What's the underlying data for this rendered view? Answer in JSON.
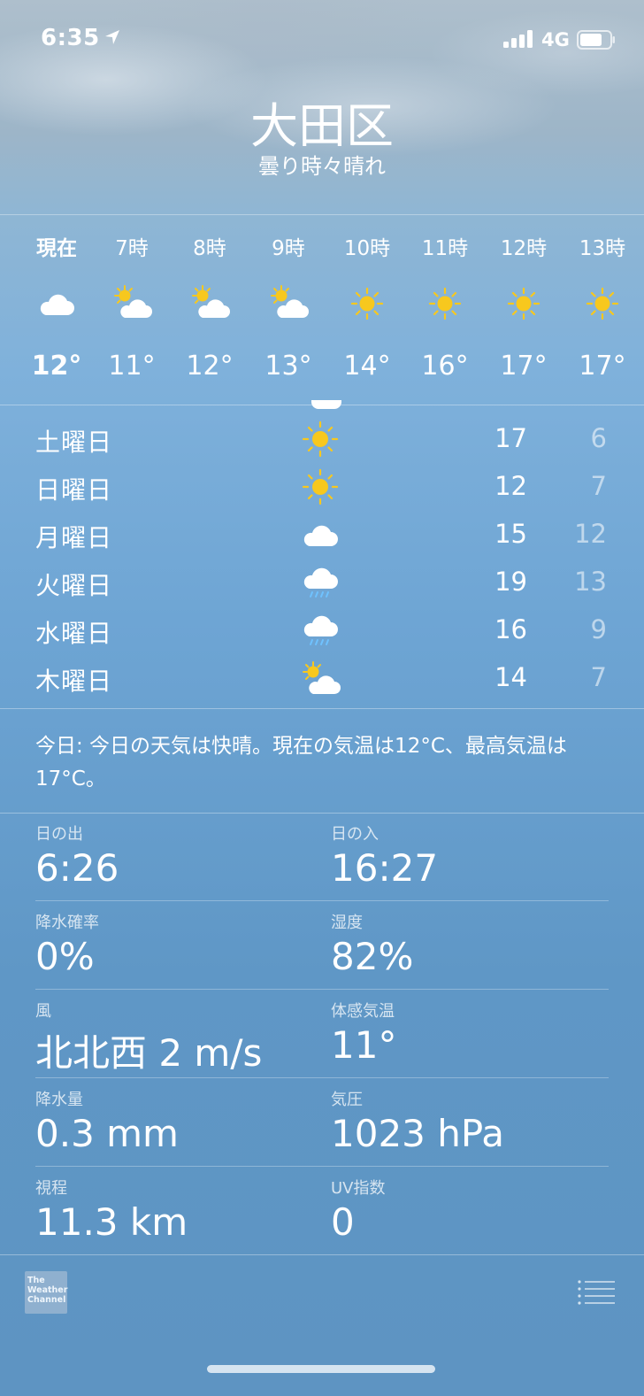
{
  "status_bar": {
    "time": "6:35",
    "network": "4G"
  },
  "location": {
    "city": "大田区",
    "condition": "曇り時々晴れ"
  },
  "hourly": [
    {
      "label": "現在",
      "icon": "cloud-icon",
      "temp": "12°"
    },
    {
      "label": "7時",
      "icon": "partly-sunny-icon",
      "temp": "11°"
    },
    {
      "label": "8時",
      "icon": "partly-sunny-icon",
      "temp": "12°"
    },
    {
      "label": "9時",
      "icon": "partly-sunny-icon",
      "temp": "13°"
    },
    {
      "label": "10時",
      "icon": "sun-icon",
      "temp": "14°"
    },
    {
      "label": "11時",
      "icon": "sun-icon",
      "temp": "16°"
    },
    {
      "label": "12時",
      "icon": "sun-icon",
      "temp": "17°"
    },
    {
      "label": "13時",
      "icon": "sun-icon",
      "temp": "17°"
    }
  ],
  "daily": [
    {
      "day": "土曜日",
      "icon": "sun-icon",
      "high": "17",
      "low": "6"
    },
    {
      "day": "日曜日",
      "icon": "sun-icon",
      "high": "12",
      "low": "7"
    },
    {
      "day": "月曜日",
      "icon": "cloud-icon",
      "high": "15",
      "low": "12"
    },
    {
      "day": "火曜日",
      "icon": "rain-icon",
      "high": "19",
      "low": "13"
    },
    {
      "day": "水曜日",
      "icon": "rain-icon",
      "high": "16",
      "low": "9"
    },
    {
      "day": "木曜日",
      "icon": "partly-sunny-icon",
      "high": "14",
      "low": "7"
    }
  ],
  "summary": "今日: 今日の天気は快晴。現在の気温は12°C、最高気温は17°C。",
  "details": {
    "sunrise": {
      "label": "日の出",
      "value": "6:26"
    },
    "sunset": {
      "label": "日の入",
      "value": "16:27"
    },
    "precip_chance": {
      "label": "降水確率",
      "value": "0%"
    },
    "humidity": {
      "label": "湿度",
      "value": "82%"
    },
    "wind": {
      "label": "風",
      "value": "北北西 2 m/s"
    },
    "feels_like": {
      "label": "体感気温",
      "value": "11°"
    },
    "precipitation": {
      "label": "降水量",
      "value": "0.3 mm"
    },
    "pressure": {
      "label": "気圧",
      "value": "1023 hPa"
    },
    "visibility": {
      "label": "視程",
      "value": "11.3 km"
    },
    "uv_index": {
      "label": "UV指数",
      "value": "0"
    }
  },
  "footer": {
    "brand_lines": [
      "The",
      "Weather",
      "Channel"
    ]
  },
  "colors": {
    "sun": "#f7c81e",
    "rain": "#6fc2ff"
  }
}
